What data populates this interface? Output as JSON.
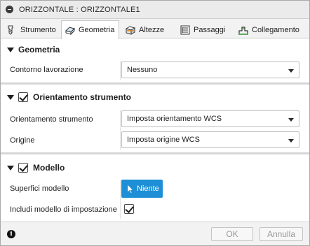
{
  "window": {
    "title": "ORIZZONTALE : ORIZZONTALE1"
  },
  "tabs": [
    {
      "label": "Strumento",
      "icon": "tool-icon"
    },
    {
      "label": "Geometria",
      "icon": "geometry-icon"
    },
    {
      "label": "Altezze",
      "icon": "heights-icon"
    },
    {
      "label": "Passaggi",
      "icon": "passes-icon"
    },
    {
      "label": "Collegamento",
      "icon": "linking-icon"
    }
  ],
  "active_tab": "Geometria",
  "sections": {
    "geometria": {
      "title": "Geometria",
      "contorno_label": "Contorno lavorazione",
      "contorno_value": "Nessuno"
    },
    "orientamento": {
      "title": "Orientamento strumento",
      "checked": true,
      "orientamento_label": "Orientamento strumento",
      "orientamento_value": "Imposta orientamento WCS",
      "origine_label": "Origine",
      "origine_value": "Imposta origine WCS"
    },
    "modello": {
      "title": "Modello",
      "checked": true,
      "superfici_label": "Superfici modello",
      "superfici_button": "Niente",
      "includi_label": "Includi modello di impostazione",
      "includi_checked": true
    }
  },
  "footer": {
    "ok_label": "OK",
    "cancel_label": "Annulla",
    "info_icon": "i"
  },
  "colors": {
    "accent": "#1e8fd6",
    "title_bar": "#ebebeb"
  }
}
